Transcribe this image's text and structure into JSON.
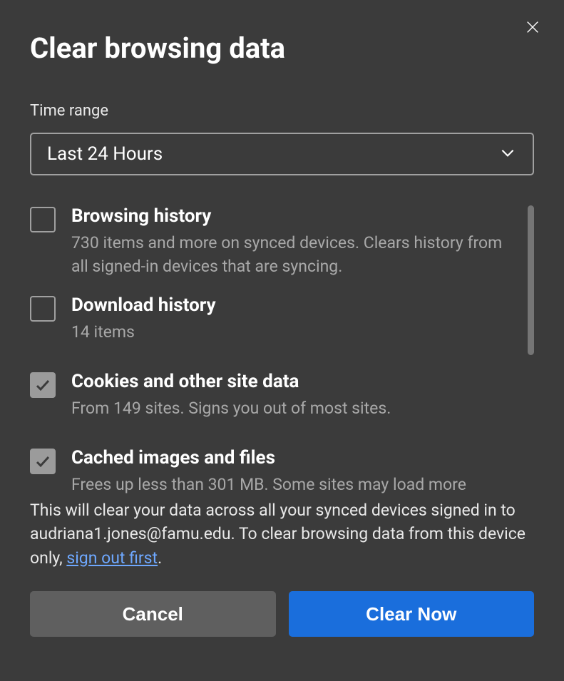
{
  "dialog": {
    "title": "Clear browsing data",
    "time_range_label": "Time range",
    "time_range_value": "Last 24 Hours"
  },
  "options": [
    {
      "title": "Browsing history",
      "desc": "730 items and more on synced devices. Clears history from all signed-in devices that are syncing.",
      "checked": false
    },
    {
      "title": "Download history",
      "desc": "14 items",
      "checked": false
    },
    {
      "title": "Cookies and other site data",
      "desc": "From 149 sites. Signs you out of most sites.",
      "checked": true
    },
    {
      "title": "Cached images and files",
      "desc": "Frees up less than 301 MB. Some sites may load more",
      "checked": true
    }
  ],
  "footer": {
    "text_before": "This will clear your data across all your synced devices signed in to audriana1.jones@famu.edu. To clear browsing data from this device only, ",
    "link_text": "sign out first",
    "text_after": "."
  },
  "buttons": {
    "cancel": "Cancel",
    "clear": "Clear Now"
  }
}
